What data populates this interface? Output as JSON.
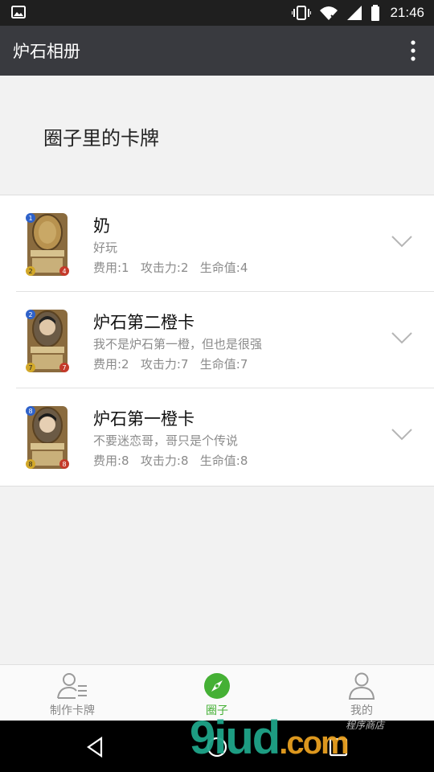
{
  "status_bar": {
    "time": "21:46"
  },
  "app_bar": {
    "title": "炉石相册"
  },
  "section": {
    "title": "圈子里的卡牌"
  },
  "cards": [
    {
      "name": "奶",
      "description": "好玩",
      "stats": "费用:1   攻击力:2   生命值:4",
      "cost": "1",
      "attack": "2",
      "health": "4"
    },
    {
      "name": "炉石第二橙卡",
      "description": "我不是炉石第一橙，但也是很强",
      "stats": "费用:2   攻击力:7   生命值:7",
      "cost": "2",
      "attack": "7",
      "health": "7"
    },
    {
      "name": "炉石第一橙卡",
      "description": "不要迷恋哥，哥只是个传说",
      "stats": "费用:8   攻击力:8   生命值:8",
      "cost": "8",
      "attack": "8",
      "health": "8"
    }
  ],
  "bottom_nav": {
    "items": [
      {
        "label": "制作卡牌",
        "icon": "user-list-icon"
      },
      {
        "label": "圈子",
        "icon": "compass-icon"
      },
      {
        "label": "我的",
        "icon": "person-icon"
      }
    ],
    "active_index": 1
  },
  "watermark": {
    "main": "9iud",
    "suffix": ".com",
    "small": "程序商店"
  },
  "colors": {
    "accent": "#45b035",
    "app_bar": "#393a3f",
    "status_bar": "#1f1f1f"
  }
}
